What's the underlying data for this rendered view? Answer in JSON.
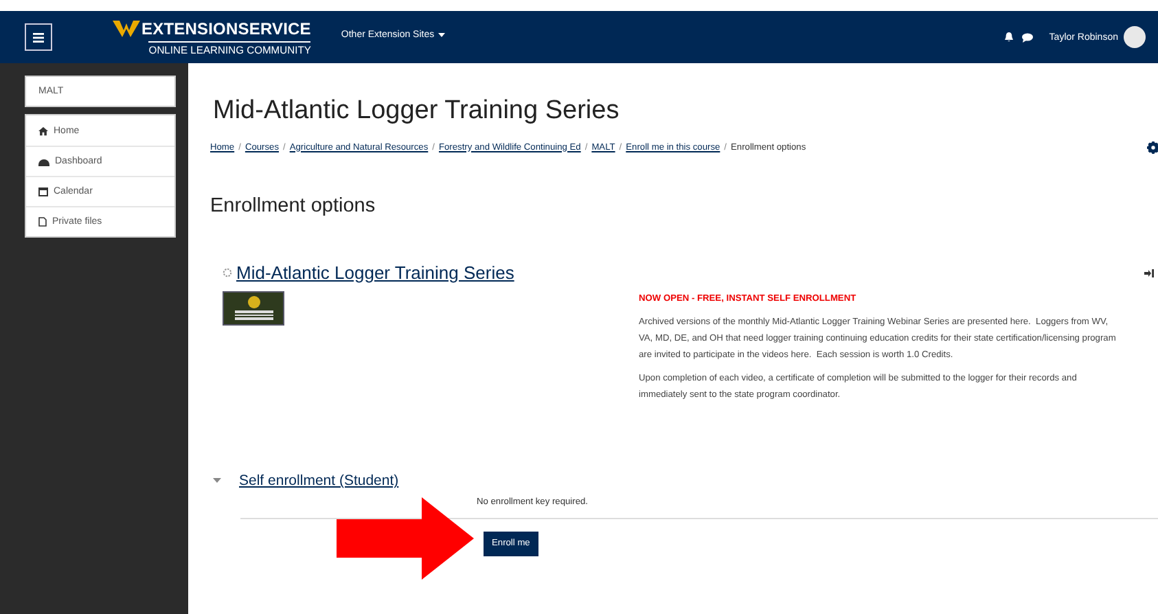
{
  "navbar": {
    "brand_title": "EXTENSIONSERVICE",
    "brand_subtitle": "ONLINE LEARNING COMMUNITY",
    "menu": "Other Extension Sites",
    "user_name": "Taylor Robinson"
  },
  "sidebar": {
    "course": "MALT",
    "items": [
      {
        "label": "Home",
        "kind": "home"
      },
      {
        "label": "Dashboard",
        "kind": "dashboard"
      },
      {
        "label": "Calendar",
        "kind": "calendar"
      },
      {
        "label": "Private files",
        "kind": "file"
      }
    ]
  },
  "page_title": "Mid-Atlantic Logger Training Series",
  "breadcrumb": [
    {
      "label": "Home",
      "link": true
    },
    {
      "separator": "/",
      "label": "Courses",
      "link": true
    },
    {
      "separator": "/",
      "label": "Agriculture and Natural Resources",
      "link": true
    },
    {
      "separator": "/",
      "label": "Forestry and Wildlife Continuing Ed",
      "link": true
    },
    {
      "separator": "/",
      "label": "MALT",
      "link": true
    },
    {
      "separator": "/",
      "label": "Enroll me in this course",
      "link": true
    },
    {
      "separator": "/",
      "label": "Enrollment options",
      "link": false
    }
  ],
  "heading": "Enrollment options",
  "course": {
    "name": "Mid-Atlantic Logger Training Series",
    "notice": "NOW OPEN - FREE, INSTANT SELF ENROLLMENT",
    "paragraphs": [
      "Archived versions of the monthly Mid-Atlantic Logger Training Webinar Series are presented here.  Loggers from WV, VA, MD, DE, and OH that need logger training continuing education credits for their state certification/licensing program are invited to participate in the videos here.  Each session is worth 1.0 Credits.",
      "Upon completion of each video, a certificate of completion will be submitted to the logger for their records and immediately sent to the state program coordinator."
    ]
  },
  "enrolment": {
    "title": "Self enrollment (Student)",
    "expanded": true,
    "note": "No enrollment key required.",
    "button": "Enroll me"
  }
}
